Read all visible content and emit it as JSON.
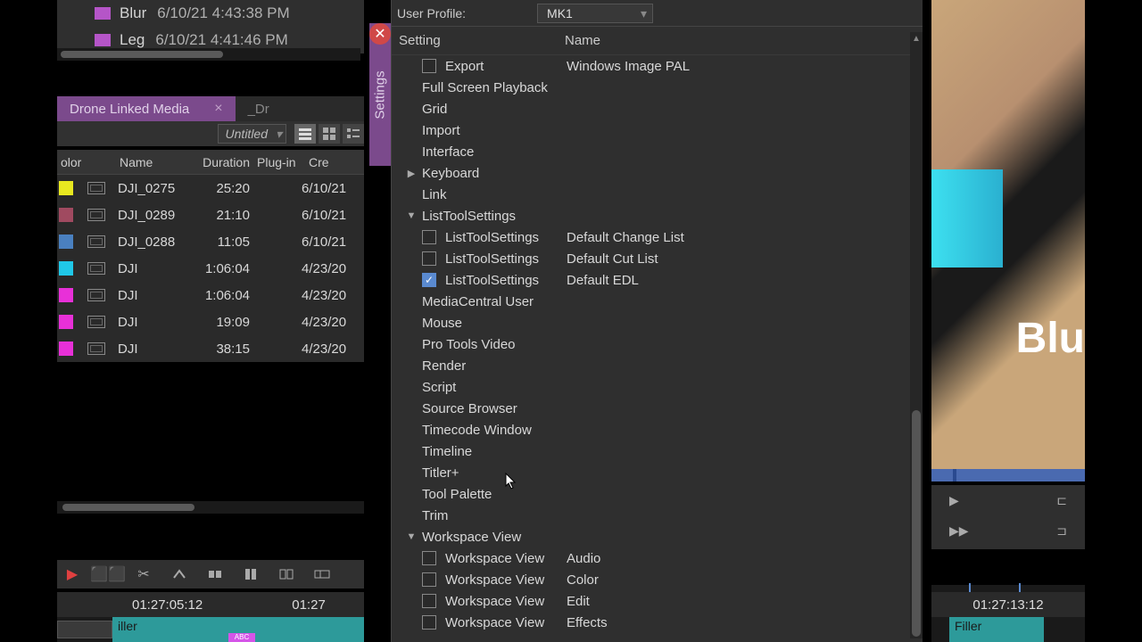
{
  "top_files": [
    {
      "name": "Blur",
      "date": "6/10/21 4:43:38 PM"
    },
    {
      "name": "Leg",
      "date": "6/10/21 4:41:46 PM"
    }
  ],
  "bin": {
    "tab1": "Drone Linked Media",
    "tab2": "_Dr",
    "dropdown": "Untitled",
    "columns": {
      "color": "olor",
      "name": "Name",
      "duration": "Duration",
      "plugin": "Plug-in",
      "created": "Cre"
    },
    "rows": [
      {
        "color": "#e8e820",
        "name": "DJI_0275",
        "duration": "25:20",
        "created": "6/10/21"
      },
      {
        "color": "#a04a60",
        "name": "DJI_0289",
        "duration": "21:10",
        "created": "6/10/21"
      },
      {
        "color": "#4a80c0",
        "name": "DJI_0288",
        "duration": "11:05",
        "created": "6/10/21"
      },
      {
        "color": "#20c8e8",
        "name": "DJI",
        "duration": "1:06:04",
        "created": "4/23/20"
      },
      {
        "color": "#e830d8",
        "name": "DJI",
        "duration": "1:06:04",
        "created": "4/23/20"
      },
      {
        "color": "#e830d8",
        "name": "DJI",
        "duration": "19:09",
        "created": "4/23/20"
      },
      {
        "color": "#e830d8",
        "name": "DJI",
        "duration": "38:15",
        "created": "4/23/20"
      }
    ]
  },
  "timeline": {
    "tc1": "01:27:05:12",
    "tc2": "01:27",
    "clip": "iller",
    "fx": "ABC"
  },
  "settings": {
    "vtab": "Settings",
    "profile_label": "User Profile:",
    "profile_value": "MK1",
    "headers": {
      "setting": "Setting",
      "name": "Name"
    },
    "items": [
      {
        "type": "check",
        "setting": "Export",
        "name": "Windows Image PAL",
        "checked": false
      },
      {
        "type": "plain",
        "setting": "Full Screen Playback"
      },
      {
        "type": "plain",
        "setting": "Grid"
      },
      {
        "type": "plain",
        "setting": "Import"
      },
      {
        "type": "plain",
        "setting": "Interface"
      },
      {
        "type": "expand",
        "setting": "Keyboard",
        "open": false
      },
      {
        "type": "plain",
        "setting": "Link"
      },
      {
        "type": "expand",
        "setting": "ListToolSettings",
        "open": true
      },
      {
        "type": "check",
        "setting": "ListToolSettings",
        "name": "Default Change List",
        "checked": false,
        "indent": true
      },
      {
        "type": "check",
        "setting": "ListToolSettings",
        "name": "Default Cut List",
        "checked": false,
        "indent": true
      },
      {
        "type": "check",
        "setting": "ListToolSettings",
        "name": "Default EDL",
        "checked": true,
        "indent": true
      },
      {
        "type": "plain",
        "setting": "MediaCentral User"
      },
      {
        "type": "plain",
        "setting": "Mouse"
      },
      {
        "type": "plain",
        "setting": "Pro Tools Video"
      },
      {
        "type": "plain",
        "setting": "Render"
      },
      {
        "type": "plain",
        "setting": "Script"
      },
      {
        "type": "plain",
        "setting": "Source Browser"
      },
      {
        "type": "plain",
        "setting": "Timecode Window"
      },
      {
        "type": "plain",
        "setting": "Timeline"
      },
      {
        "type": "plain",
        "setting": "Titler+"
      },
      {
        "type": "plain",
        "setting": "Tool Palette"
      },
      {
        "type": "plain",
        "setting": "Trim"
      },
      {
        "type": "expand",
        "setting": "Workspace View",
        "open": true
      },
      {
        "type": "check",
        "setting": "Workspace View",
        "name": "Audio",
        "checked": false,
        "indent": true
      },
      {
        "type": "check",
        "setting": "Workspace View",
        "name": "Color",
        "checked": false,
        "indent": true
      },
      {
        "type": "check",
        "setting": "Workspace View",
        "name": "Edit",
        "checked": false,
        "indent": true
      },
      {
        "type": "check",
        "setting": "Workspace View",
        "name": "Effects",
        "checked": false,
        "indent": true
      }
    ]
  },
  "viewer": {
    "overlay": "Blu"
  },
  "right_timeline": {
    "tc": "01:27:13:12",
    "clip": "Filler"
  }
}
